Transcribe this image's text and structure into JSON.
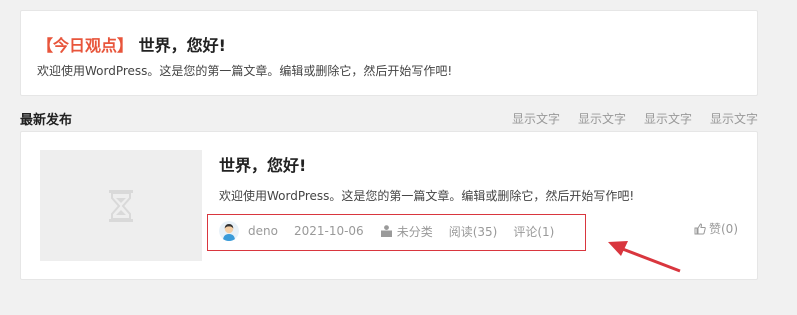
{
  "featured": {
    "tag": "【今日观点】",
    "title": "世界，您好!",
    "excerpt": "欢迎使用WordPress。这是您的第一篇文章。编辑或删除它，然后开始写作吧!"
  },
  "section": {
    "title": "最新发布",
    "links": [
      "显示文字",
      "显示文字",
      "显示文字",
      "显示文字"
    ]
  },
  "post": {
    "title": "世界，您好!",
    "excerpt": "欢迎使用WordPress。这是您的第一篇文章。编辑或删除它，然后开始写作吧!",
    "author": "deno",
    "date": "2021-10-06",
    "category": "未分类",
    "views": "阅读(35)",
    "comments": "评论(1)",
    "like": "赞(0)",
    "thumbnail_icon": "hourglass-placeholder-icon",
    "avatar_icon": "user-avatar-icon"
  },
  "annotation": {
    "color": "#d9363e",
    "shapes": [
      "highlight-box",
      "arrow"
    ]
  }
}
